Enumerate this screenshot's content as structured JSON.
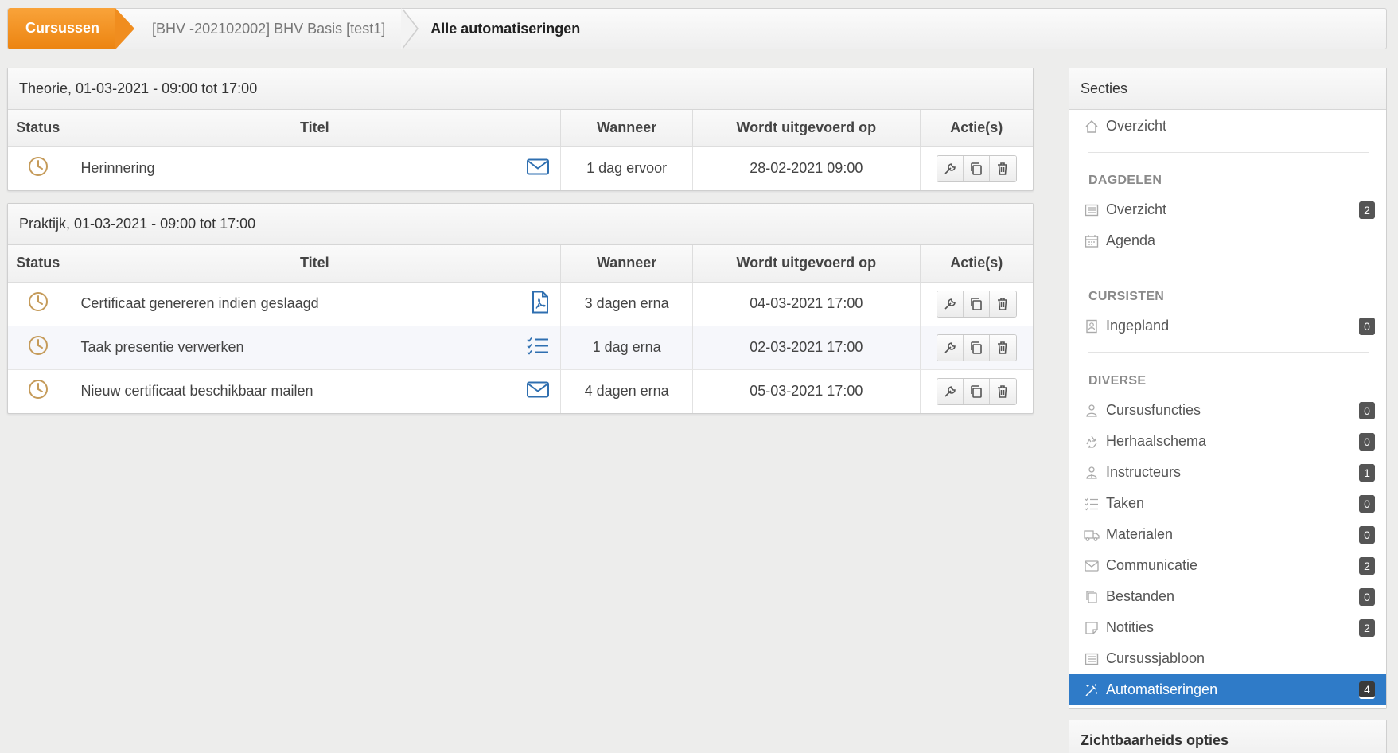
{
  "breadcrumb": {
    "first": "Cursussen",
    "second": "[BHV -202102002] BHV Basis [test1]",
    "current": "Alle automatiseringen"
  },
  "columns": {
    "status": "Status",
    "titel": "Titel",
    "wanneer": "Wanneer",
    "uitgevoerd": "Wordt uitgevoerd op",
    "acties": "Actie(s)"
  },
  "panels": [
    {
      "title": "Theorie, 01-03-2021 - 09:00 tot 17:00",
      "rows": [
        {
          "title": "Herinnering",
          "type_icon": "envelope-icon",
          "wanneer": "1 dag ervoor",
          "uitgevoerd": "28-02-2021 09:00"
        }
      ]
    },
    {
      "title": "Praktijk, 01-03-2021 - 09:00 tot 17:00",
      "rows": [
        {
          "title": "Certificaat genereren indien geslaagd",
          "type_icon": "pdf-icon",
          "wanneer": "3 dagen erna",
          "uitgevoerd": "04-03-2021 17:00"
        },
        {
          "title": "Taak presentie verwerken",
          "type_icon": "tasklist-icon",
          "wanneer": "1 dag erna",
          "uitgevoerd": "02-03-2021 17:00"
        },
        {
          "title": "Nieuw certificaat beschikbaar mailen",
          "type_icon": "envelope-icon",
          "wanneer": "4 dagen erna",
          "uitgevoerd": "05-03-2021 17:00"
        }
      ]
    }
  ],
  "sidebar": {
    "title": "Secties",
    "overview": "Overzicht",
    "groups": {
      "dagdelen": "DAGDELEN",
      "cursisten": "CURSISTEN",
      "diverse": "DIVERSE"
    },
    "dagdelen": [
      {
        "label": "Overzicht",
        "badge": "2",
        "icon": "list-icon"
      },
      {
        "label": "Agenda",
        "badge": "",
        "icon": "calendar-icon"
      }
    ],
    "cursisten": [
      {
        "label": "Ingepland",
        "badge": "0",
        "icon": "id-card-icon"
      }
    ],
    "diverse": [
      {
        "label": "Cursusfuncties",
        "badge": "0",
        "icon": "users-icon"
      },
      {
        "label": "Herhaalschema",
        "badge": "0",
        "icon": "recycle-icon"
      },
      {
        "label": "Instructeurs",
        "badge": "1",
        "icon": "instructor-icon"
      },
      {
        "label": "Taken",
        "badge": "0",
        "icon": "tasklist-icon"
      },
      {
        "label": "Materialen",
        "badge": "0",
        "icon": "truck-icon"
      },
      {
        "label": "Communicatie",
        "badge": "2",
        "icon": "envelope-icon"
      },
      {
        "label": "Bestanden",
        "badge": "0",
        "icon": "files-icon"
      },
      {
        "label": "Notities",
        "badge": "2",
        "icon": "note-icon"
      },
      {
        "label": "Cursussjabloon",
        "badge": "",
        "icon": "list-icon"
      },
      {
        "label": "Automatiseringen",
        "badge": "4",
        "icon": "magic-wand-icon"
      }
    ],
    "visibility_title": "Zichtbaarheids opties"
  }
}
